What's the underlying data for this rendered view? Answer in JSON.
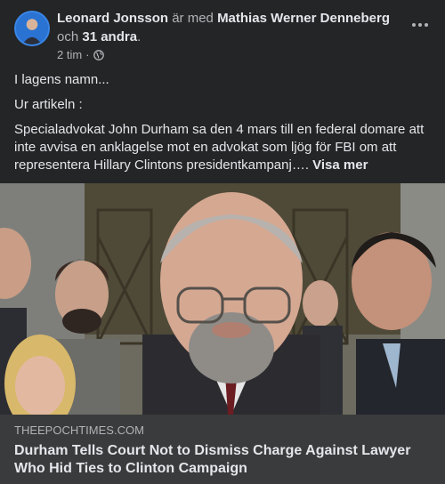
{
  "post": {
    "author": "Leonard Jonsson",
    "with_text": "är med",
    "tagged": "Mathias Werner Denneberg",
    "and_text": "och",
    "others": "31 andra",
    "period": ".",
    "time": "2 tim",
    "separator": "·",
    "privacy_icon": "globe-icon",
    "more_icon": "more-options-icon",
    "paragraphs": [
      "I lagens namn...",
      "Ur artikeln :",
      "Specialadvokat John Durham sa den 4 mars till en federal domare att inte avvisa en anklagelse mot en advokat som ljög för FBI om att representera Hillary Clintons presidentkampanj…."
    ],
    "see_more": "Visa mer"
  },
  "link_preview": {
    "domain": "THEEPOCHTIMES.COM",
    "title": "Durham Tells Court Not to Dismiss Charge Against Lawyer Who Hid Ties to Clinton Campaign"
  },
  "colors": {
    "background": "#242526",
    "card": "#3a3b3c",
    "text": "#e4e6eb",
    "secondary_text": "#b0b3b8"
  }
}
